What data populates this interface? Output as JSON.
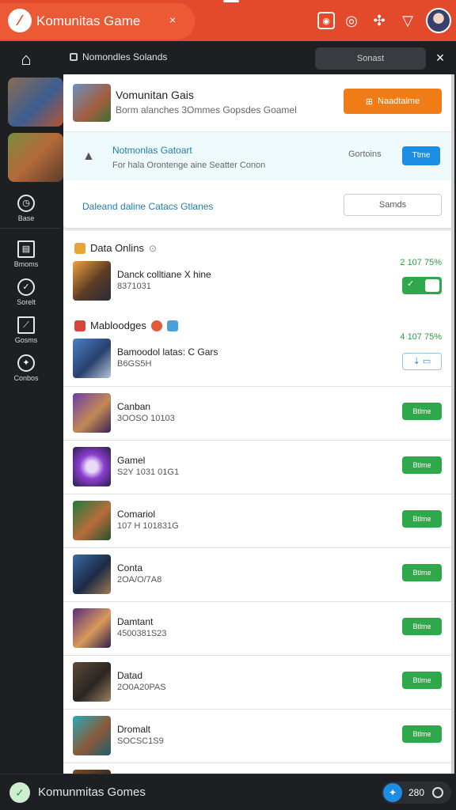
{
  "app": {
    "title": "Komunitas Game",
    "tab_close": "×",
    "logo": "⁄"
  },
  "topbar_icons": [
    "image-icon",
    "target-icon",
    "puzzle-icon",
    "cart-icon"
  ],
  "rail": {
    "items": [
      {
        "label": "Base",
        "icon": "clock-icon"
      },
      {
        "label": "Bmoms",
        "icon": "grid-icon"
      },
      {
        "label": "Sorelt",
        "icon": "check-circle-icon"
      },
      {
        "label": "Gosms",
        "icon": "chart-icon"
      },
      {
        "label": "Conbos",
        "icon": "compass-icon"
      }
    ]
  },
  "subhead": {
    "breadcrumb": "Nomondles Solands",
    "search_placeholder": "Sonast",
    "close": "×"
  },
  "featured": {
    "title": "Vomunitan Gais",
    "subtitle": "Borm alanches 3Ommes Gopsdes Goamel",
    "action_label": "Naadtalme",
    "notice_title": "Notmonlas Gatoart",
    "notice_sub": "For hala Orontenge aine Seatter Conon",
    "notice_label": "Gortoins",
    "notice_button": "Ttme",
    "link": "Daleand daline Catacs Gtlanes",
    "outline_button": "Samds"
  },
  "sections": [
    {
      "title": "Data Onlins",
      "stat": "2 107 75%"
    },
    {
      "title": "Mabloodges",
      "stat": "4 107 75%"
    }
  ],
  "rows": [
    {
      "title": "Danck colltiane X hine",
      "sub": "8371031",
      "control": "toggle"
    },
    {
      "title": "Bamoodol latas: C Gars",
      "sub": "B6GS5H",
      "control": "blue"
    },
    {
      "title": "Canban",
      "sub": "3OOSO 10103",
      "button": "Btlme"
    },
    {
      "title": "Gamel",
      "sub": "S2Y 1031 01G1",
      "button": "Btlme"
    },
    {
      "title": "Comariol",
      "sub": "107 H 101831G",
      "button": "Btlme"
    },
    {
      "title": "Conta",
      "sub": "2OA/O/7A8",
      "button": "Btlme"
    },
    {
      "title": "Damtant",
      "sub": "4500381S23",
      "button": "Btlme"
    },
    {
      "title": "Datad",
      "sub": "2O0A20PAS",
      "button": "Btlme"
    },
    {
      "title": "Dromalt",
      "sub": "SOCSC1S9",
      "button": "Btlme"
    }
  ],
  "status": {
    "text": "Komunmitas Gomes",
    "count": "280"
  },
  "colors": {
    "brand": "#e3492b",
    "accent_orange": "#f07c18",
    "accent_green": "#2ea84a",
    "accent_blue": "#1b8ee3",
    "rail_bg": "#1e1f23"
  }
}
